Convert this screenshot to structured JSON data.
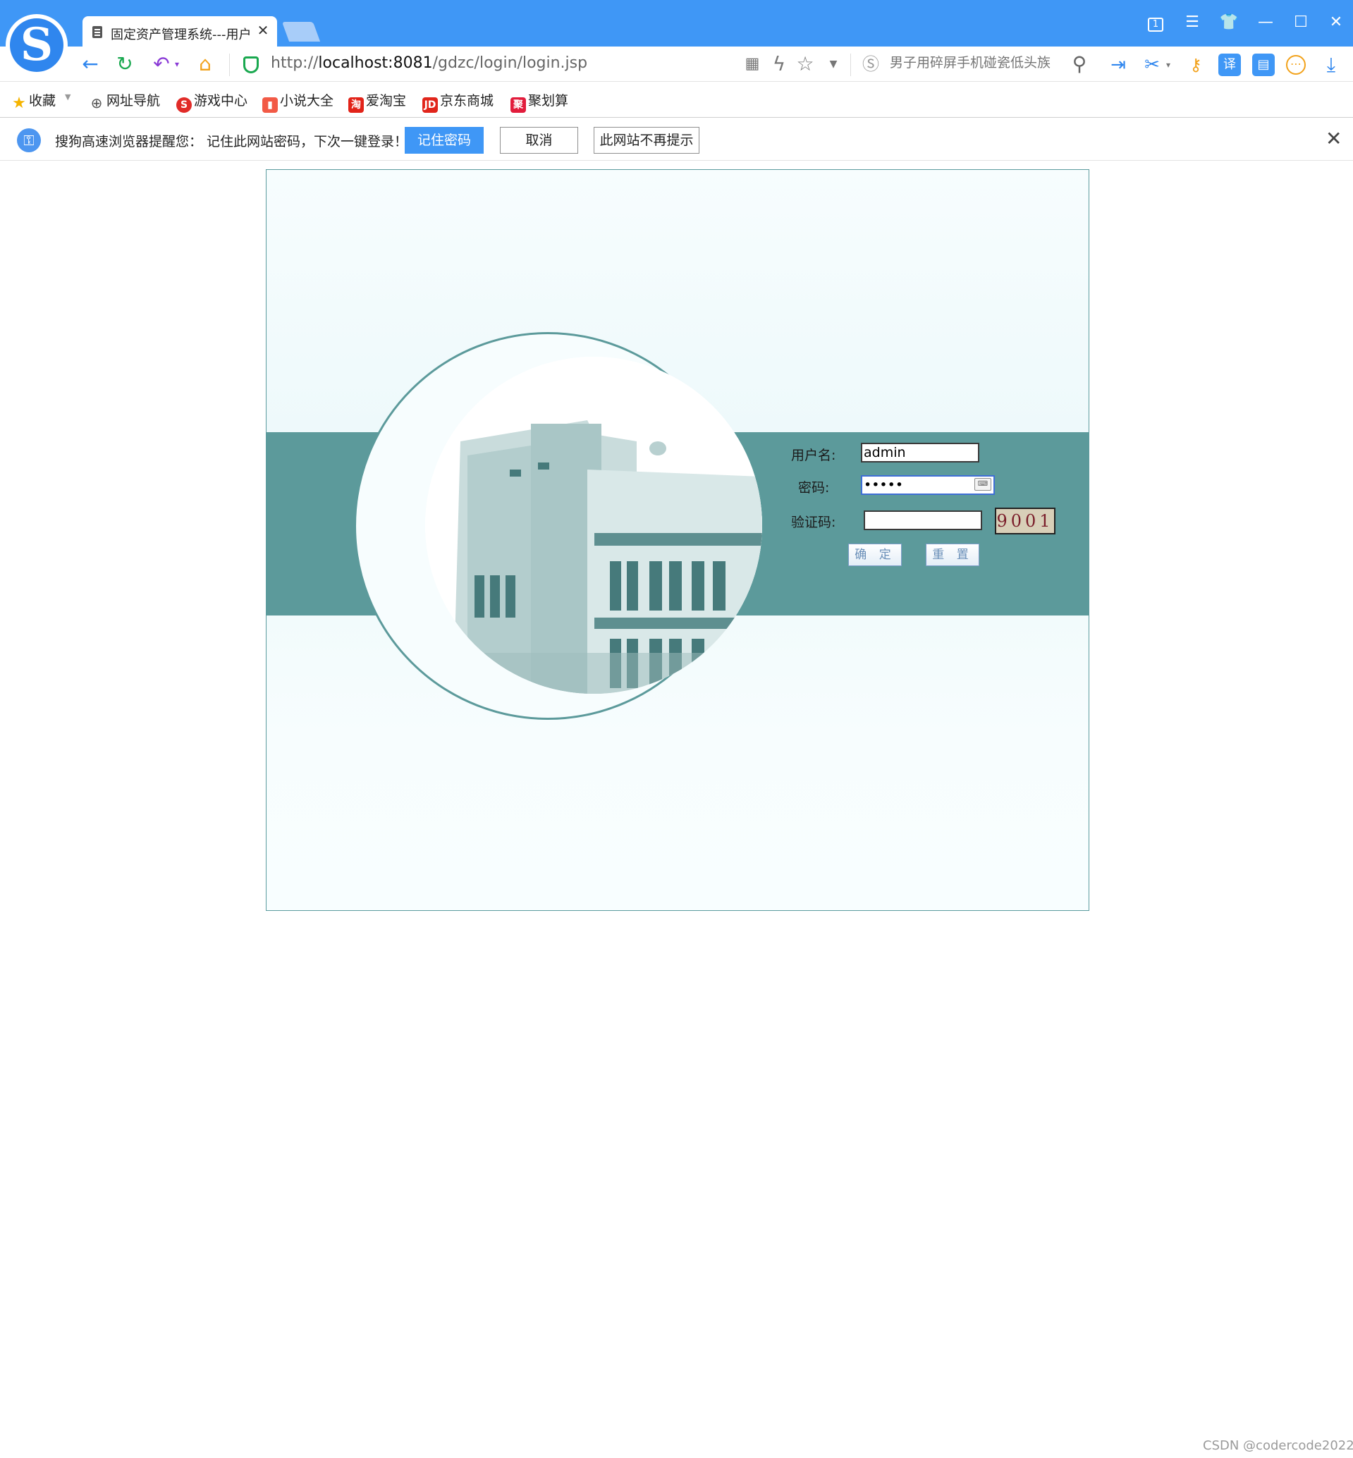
{
  "browser": {
    "tab": {
      "title": "固定资产管理系统---用户",
      "close": "✕"
    },
    "window_buttons": {
      "count": "1",
      "menu": "☰",
      "skin": "👕",
      "minimize": "—",
      "maximize": "☐",
      "close": "✕"
    },
    "address": {
      "url_prefix": "http://",
      "url_host": "localhost:8081",
      "url_path": "/gdzc/login/login.jsp",
      "search_placeholder": "男子用碎屏手机碰瓷低头族"
    },
    "bookmarks": [
      {
        "label": "收藏"
      },
      {
        "label": "网址导航"
      },
      {
        "label": "游戏中心",
        "icon_text": "S"
      },
      {
        "label": "小说大全",
        "icon_text": "▮"
      },
      {
        "label": "爱淘宝",
        "icon_text": "淘"
      },
      {
        "label": "京东商城",
        "icon_text": "JD"
      },
      {
        "label": "聚划算",
        "icon_text": "聚"
      }
    ],
    "password_prompt": {
      "message": "搜狗高速浏览器提醒您：  记住此网站密码，下次一键登录！",
      "remember": "记住密码",
      "cancel": "取消",
      "never": "此网站不再提示"
    }
  },
  "login": {
    "username_label": "用户名:",
    "username_value": "admin",
    "password_label": "密码:",
    "password_value": "•••••",
    "code_label": "验证码:",
    "code_value": "",
    "captcha": "9001",
    "submit": "确 定",
    "reset": "重 置"
  },
  "watermark": "CSDN @codercode2022",
  "colors": {
    "chrome_blue": "#3f97f6",
    "teal_band": "#5c9a9b",
    "page_bg": "#f6fdfe"
  }
}
